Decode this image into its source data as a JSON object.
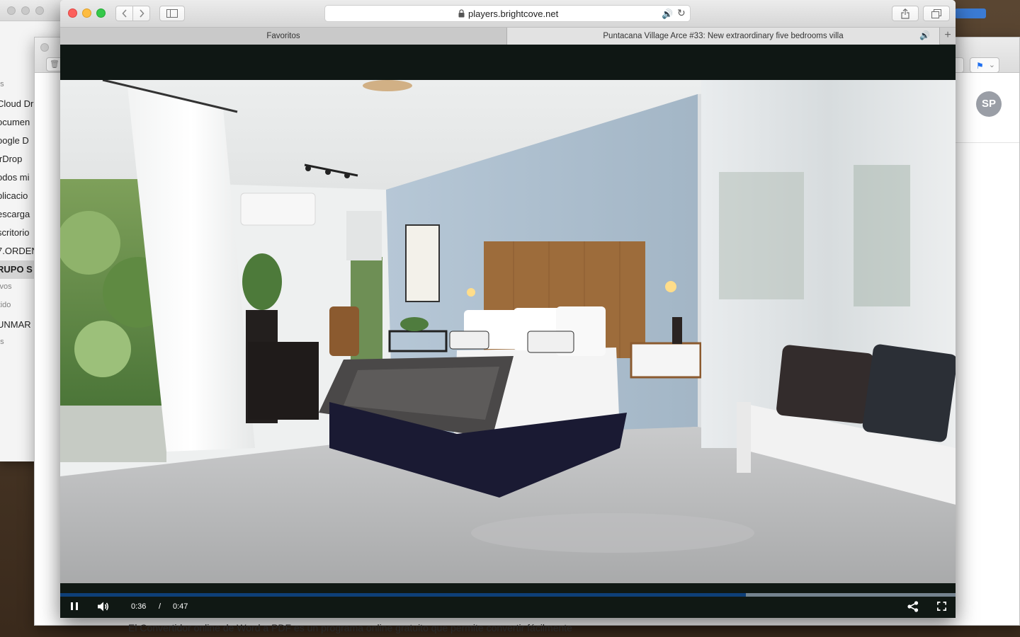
{
  "browser": {
    "url": "players.brightcove.net",
    "tabs": [
      {
        "label": "Favoritos",
        "active": false
      },
      {
        "label": "Puntacana Village Arce #33: New extraordinary five bedrooms villa",
        "active": true,
        "playing_audio": true
      }
    ],
    "new_tab_label": "+"
  },
  "player": {
    "current_time": "0:36",
    "separator": "/",
    "duration": "0:47",
    "progress": 0.766,
    "state": "playing",
    "progress_fill_color": "#0e3f78",
    "controls": [
      "pause-icon",
      "volume-icon",
      "share-icon",
      "fullscreen-icon"
    ]
  },
  "finder_sidebar": {
    "items": [
      {
        "label": "os",
        "type": "section"
      },
      {
        "label": "Cloud Dr",
        "type": "item"
      },
      {
        "label": "ocumen",
        "type": "item"
      },
      {
        "label": "oogle D",
        "type": "item"
      },
      {
        "label": "irDrop",
        "type": "item"
      },
      {
        "label": "odos mi",
        "type": "item"
      },
      {
        "label": "plicacio",
        "type": "item"
      },
      {
        "label": "escarga",
        "type": "item"
      },
      {
        "label": "scritorio",
        "type": "item"
      },
      {
        "label": "7.ORDEN",
        "type": "item"
      },
      {
        "label": "RUPO S",
        "type": "item",
        "selected": true
      },
      {
        "label": "tivos",
        "type": "section"
      },
      {
        "label": "rtido",
        "type": "section"
      },
      {
        "label": "UNMAR",
        "type": "item"
      },
      {
        "label": "as",
        "type": "section"
      }
    ]
  },
  "mail": {
    "avatar_initials": "SP",
    "body_snippet": "El Convertidor online de Word a PDF es un programa online gratuito que permite convertir fácilmente"
  }
}
